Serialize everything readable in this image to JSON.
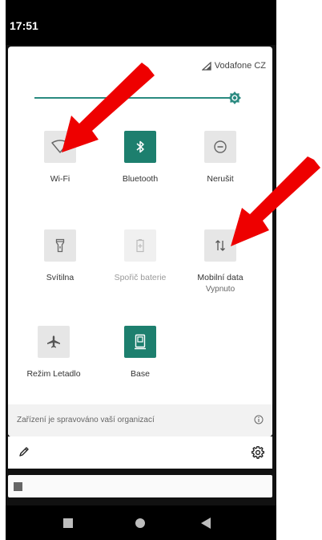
{
  "status_bar": {
    "time": "17:51"
  },
  "quick_settings": {
    "carrier": "Vodafone CZ",
    "brightness_level": 0.97,
    "tiles": [
      {
        "id": "wifi",
        "label": "Wi-Fi",
        "state": "off",
        "icon": "wifi-icon"
      },
      {
        "id": "bluetooth",
        "label": "Bluetooth",
        "state": "on",
        "icon": "bluetooth-icon"
      },
      {
        "id": "dnd",
        "label": "Nerušit",
        "state": "off",
        "icon": "do-not-disturb-icon"
      },
      {
        "id": "flashlight",
        "label": "Svítilna",
        "state": "off",
        "icon": "flashlight-icon"
      },
      {
        "id": "battery_saver",
        "label": "Spořič baterie",
        "state": "disabled",
        "icon": "battery-saver-icon"
      },
      {
        "id": "mobile_data",
        "label": "Mobilní data",
        "sublabel": "Vypnuto",
        "state": "off",
        "icon": "mobile-data-icon"
      },
      {
        "id": "airplane",
        "label": "Režim Letadlo",
        "state": "off",
        "icon": "airplane-icon"
      },
      {
        "id": "base",
        "label": "Base",
        "state": "on",
        "icon": "base-device-icon"
      }
    ]
  },
  "footer": {
    "managed_text": "Zařízení je spravováno vaší organizací"
  },
  "colors": {
    "accent": "#1d7f6e",
    "slider": "#2a8a80",
    "arrow": "#ee0000"
  }
}
